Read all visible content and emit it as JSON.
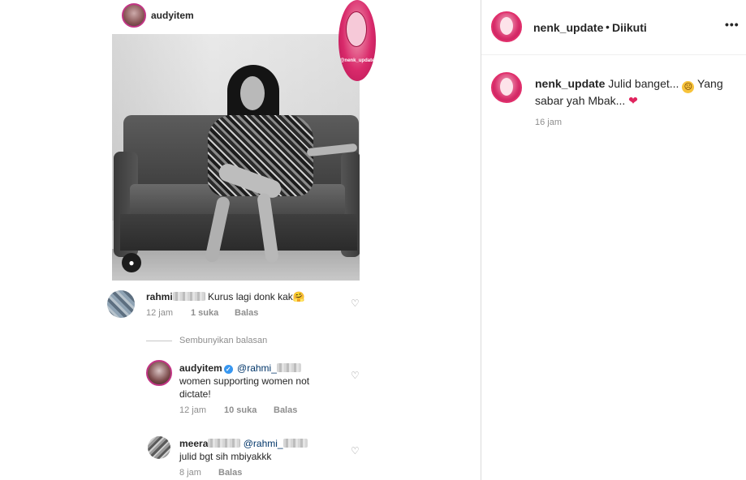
{
  "post": {
    "username": "nenk_update",
    "separator": "•",
    "follow_status": "Diikuti",
    "more_glyph": "•••"
  },
  "caption": {
    "username": "nenk_update",
    "text_1": "Julid banget...",
    "text_2": "Yang sabar yah Mbak...",
    "time": "16 jam"
  },
  "embedded": {
    "username": "audyitem",
    "watermark_text": "@nenk_update",
    "comments": [
      {
        "username": "rahmi",
        "text": "Kurus lagi donk kak🤗",
        "time": "12 jam",
        "likes": "1 suka",
        "reply": "Balas"
      }
    ],
    "hide_replies": "Sembunyikan balasan",
    "replies": [
      {
        "username": "audyitem",
        "mention": "@rahmi_",
        "text": "women supporting women not dictate!",
        "time": "12 jam",
        "likes": "10 suka",
        "reply": "Balas"
      },
      {
        "username": "meera",
        "mention": "@rahmi_",
        "text": "julid bgt sih mbiyakkk",
        "time": "8 jam",
        "reply": "Balas"
      }
    ]
  },
  "icons": {
    "heart": "heart-outline-icon",
    "more": "more-options-icon",
    "verified": "verified-badge-icon",
    "user_tag": "user-tag-icon"
  },
  "colors": {
    "text": "#262626",
    "muted": "#8e8e8e",
    "verified": "#3897f0",
    "story_ring": "#e1306c",
    "heart_emoji": "#e0245e"
  }
}
